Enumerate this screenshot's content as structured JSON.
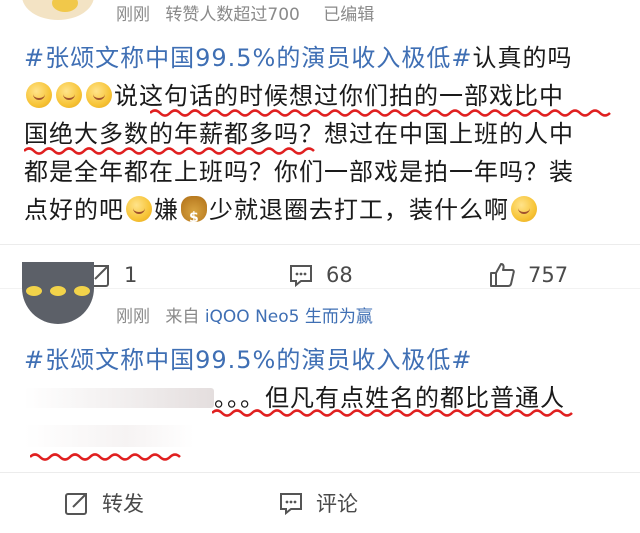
{
  "post1": {
    "time": "刚刚",
    "reposts_note": "转赞人数超过700",
    "edited": "已编辑",
    "hashtag": "#张颂文称中国99.5%的演员收入极低#",
    "line1_rest": "认真的吗",
    "line2_text": "说这句话的时候想过你们拍的一部戏比中",
    "line3_text": "国绝大多数的年薪都多吗？想过在中国上班的人中",
    "line4_text": "都是全年都在上班吗？你们一部戏是拍一年吗？装",
    "line5_a": "点好的吧",
    "line5_b": "嫌",
    "line5_c": "少就退圈去打工，装什么啊",
    "repost_count": "1",
    "comment_count": "68",
    "like_count": "757"
  },
  "post2": {
    "time": "刚刚",
    "source_prefix": "来自",
    "source_device": "iQOO Neo5 生而为赢",
    "hashtag": "#张颂文称中国99.5%的演员收入极低#",
    "line2_text": "。。。但凡有点姓名的都比普通人"
  },
  "footer": {
    "repost_label": "转发",
    "comment_label": "评论"
  },
  "colors": {
    "link_blue": "#3f6fb4",
    "underline_red": "#e02020",
    "meta_gray": "#8a8a8a"
  }
}
